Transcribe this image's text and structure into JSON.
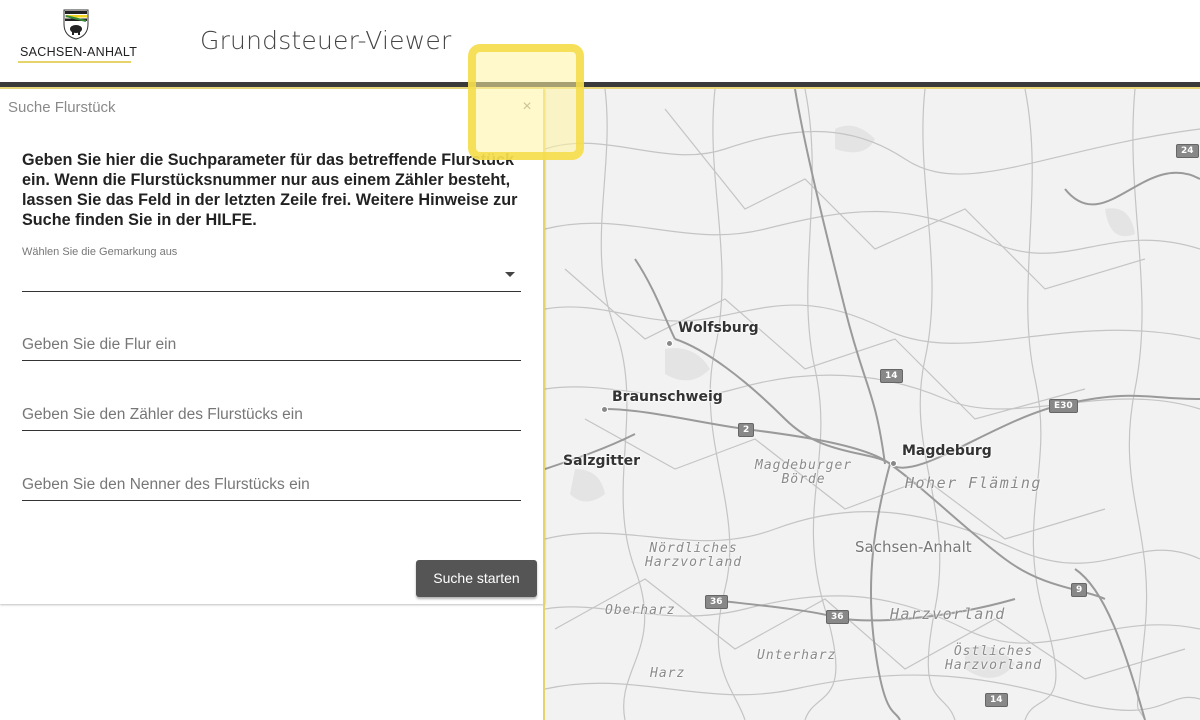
{
  "header": {
    "logo_text": "SACHSEN-ANHALT",
    "app_title": "Grundsteuer-Viewer"
  },
  "panel": {
    "title": "Suche Flurstück",
    "close_label": "×",
    "instructions": "Geben Sie hier die Suchparameter für das betreffende Flurstück ein. Wenn die Flurstücksnummer nur aus einem Zähler besteht, lassen Sie das Feld in der letzten Zeile frei. Weitere Hinweise zur Suche finden Sie in der HILFE.",
    "gemarkung": {
      "label": "Wählen Sie die Gemarkung aus",
      "value": ""
    },
    "flur": {
      "placeholder": "Geben Sie die Flur ein"
    },
    "zaehler": {
      "placeholder": "Geben Sie den Zähler des Flurstücks ein"
    },
    "nenner": {
      "placeholder": "Geben Sie den Nenner des Flurstücks ein"
    },
    "search_button": "Suche starten"
  },
  "map": {
    "cities": [
      "Wolfsburg",
      "Braunschweig",
      "Salzgitter",
      "Magdeburg"
    ],
    "regions": {
      "magdeburger_boerde": "Magdeburger\nBörde",
      "hoher_flaeming": "Hoher Fläming",
      "noerdliches_harzvorland": "Nördliches\nHarzvorland",
      "oberharz": "Oberharz",
      "harzvorland": "Harzvorland",
      "unterharz": "Unterharz",
      "oestliches_harzvorland": "Östliches\nHarzvorland",
      "harz": "Harz"
    },
    "state": "Sachsen-Anhalt",
    "shields": [
      "24",
      "14",
      "E30",
      "2",
      "36",
      "36",
      "9",
      "14"
    ]
  }
}
